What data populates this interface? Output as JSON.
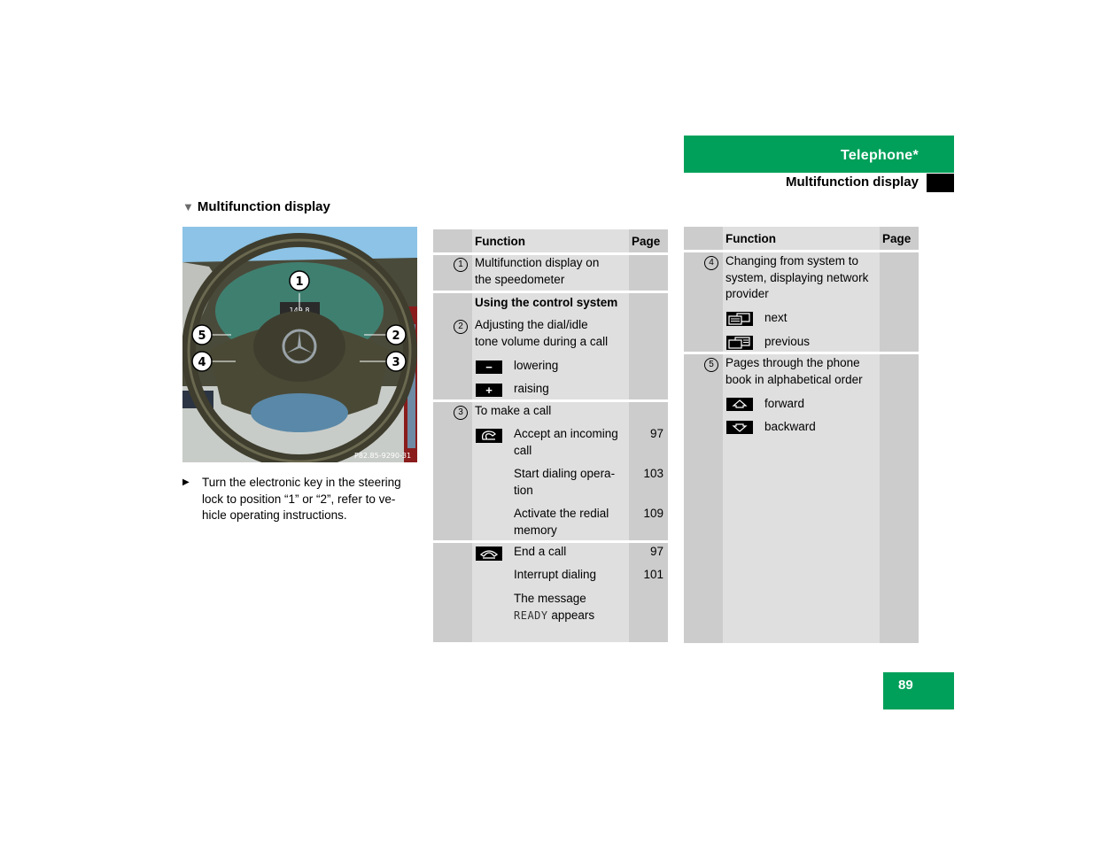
{
  "header": {
    "chapter": "Telephone*",
    "section": "Multifunction display"
  },
  "section_title": "Multifunction display",
  "illustration": {
    "code": "P82.85-9290-31",
    "callouts": [
      "1",
      "2",
      "3",
      "4",
      "5"
    ],
    "display_readout": "149.8"
  },
  "instruction": "Turn the electronic key in the steering lock to position “1” or “2”, refer to vehicle operating instructions.",
  "instruction_lines": [
    "Turn the electronic key in the steering",
    "lock to position “1” or “2”, refer to ve-",
    "hicle operating instructions."
  ],
  "table_left": {
    "headers": {
      "function": "Function",
      "page": "Page"
    },
    "item1": {
      "num": "1",
      "lines": [
        "Multifunction display on",
        "the speedometer"
      ]
    },
    "control_heading": "Using the control system",
    "item2": {
      "num": "2",
      "lines": [
        "Adjusting the dial/idle",
        "tone volume during a call"
      ],
      "keys": [
        {
          "icon": "minus-key-icon",
          "glyph": "−",
          "label": "lowering"
        },
        {
          "icon": "plus-key-icon",
          "glyph": "+",
          "label": "raising"
        }
      ]
    },
    "item3": {
      "num": "3",
      "label": "To make a call",
      "accept": {
        "icon": "phone-pickup-key-icon",
        "rows": [
          {
            "lines": [
              "Accept an incoming",
              "call"
            ],
            "page": "97"
          },
          {
            "lines": [
              "Start dialing opera-",
              "tion"
            ],
            "page": "103"
          },
          {
            "lines": [
              "Activate the redial",
              "memory"
            ],
            "page": "109"
          }
        ]
      },
      "end": {
        "icon": "phone-hangup-key-icon",
        "rows": [
          {
            "lines": [
              "End a call"
            ],
            "page": "97"
          },
          {
            "lines": [
              "Interrupt dialing"
            ],
            "page": "101"
          },
          {
            "lines": [
              "The message"
            ],
            "mono": "READY",
            "tail": " appears",
            "page": ""
          }
        ]
      }
    }
  },
  "table_right": {
    "headers": {
      "function": "Function",
      "page": "Page"
    },
    "item4": {
      "num": "4",
      "lines": [
        "Changing from system to",
        "system, displaying network",
        "provider"
      ],
      "keys": [
        {
          "icon": "next-screen-key-icon",
          "label": "next"
        },
        {
          "icon": "previous-screen-key-icon",
          "label": "previous"
        }
      ]
    },
    "item5": {
      "num": "5",
      "lines": [
        "Pages through the phone",
        "book in alphabetical order"
      ],
      "keys": [
        {
          "icon": "up-arrow-key-icon",
          "label": "forward"
        },
        {
          "icon": "down-arrow-key-icon",
          "label": "backward"
        }
      ]
    }
  },
  "page_number": "89",
  "colors": {
    "brand_green": "#00a05a",
    "table_dark": "#cccccc",
    "table_light": "#dfdfdf"
  }
}
